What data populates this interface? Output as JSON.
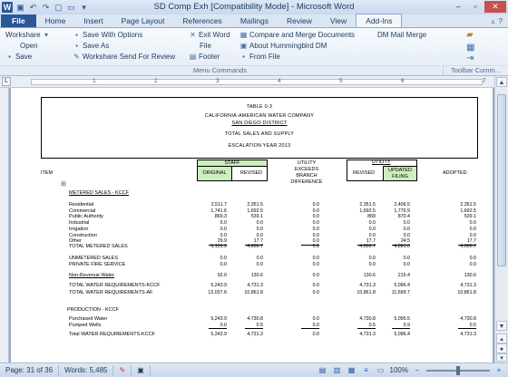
{
  "window": {
    "title": "SD Comp Exh [Compatibility Mode] - Microsoft Word",
    "app_letter": "W"
  },
  "ribbon_tabs": [
    "Home",
    "Insert",
    "Page Layout",
    "References",
    "Mailings",
    "Review",
    "View",
    "Add-Ins"
  ],
  "file_tab": "File",
  "ribbon": {
    "workshare": "Workshare",
    "open": "Open",
    "save": "Save",
    "save_with_options": "Save With Options",
    "save_as": "Save As",
    "workshare_send": "Workshare Send For Review",
    "exit_word": "Exit Word",
    "file": "File",
    "footer": "Footer",
    "compare_merge": "Compare and Merge Documents",
    "about_hummingbird": "About Hummingbird DM",
    "from_file": "From File",
    "dm_mail_merge": "DM Mail Merge",
    "menu_commands": "Menu Commands",
    "toolbar_commands": "Toolbar Comm..."
  },
  "ruler_numbers": [
    "1",
    "2",
    "3",
    "4",
    "5",
    "6",
    "7"
  ],
  "doc": {
    "table_no": "TABLE 0-3",
    "company": "CALIFORNIA-AMERICAN WATER COMPANY",
    "district": "SAN DIEGO DISTRICT",
    "subtitle": "TOTAL SALES AND SUPPLY",
    "year": "ESCALATION  YEAR 2013",
    "col_staff": "STAFF",
    "col_utility": "UTILITY",
    "col_original": "ORIGINAL",
    "col_revised": "REVISED",
    "col_exceeds": "UTILITY EXCEEDS BRANCH DIFFERENCE",
    "col_u_revised": "REVISED",
    "col_updated": "UPDATED FILING",
    "col_adopted": "ADOPTED",
    "item": "ITEM",
    "metered_sales": "METERED SALES - KCCF",
    "rows": [
      {
        "label": "Residential",
        "v": [
          "2,511.7",
          "2,351.5",
          "0.0",
          "2,351.5",
          "2,406.5",
          "2,351.5"
        ]
      },
      {
        "label": "Commercial",
        "v": [
          "1,741.6",
          "1,692.5",
          "0.0",
          "1,692.5",
          "1,776.9",
          "1,692.5"
        ]
      },
      {
        "label": "Public Authority",
        "v": "869.3|539.1|0.0|869|870.4|539.1"
      },
      {
        "label": "Industrial",
        "v": [
          "0.0",
          "0.0",
          "0.0",
          "0.0",
          "0.0",
          "0.0"
        ]
      },
      {
        "label": "Irrigation",
        "v": [
          "0.0",
          "0.0",
          "0.0",
          "0.0",
          "0.0",
          "0.0"
        ]
      },
      {
        "label": "Construction",
        "v": [
          "0.0",
          "0.0",
          "0.0",
          "0.0",
          "0.0",
          "0.0"
        ]
      },
      {
        "label": "Other",
        "v": [
          "29.9",
          "17.7",
          "0.0",
          "17.7",
          "24.5",
          "17.7"
        ]
      }
    ],
    "total_metered": {
      "label": "TOTAL METERED SALES",
      "v": [
        "5,151.9",
        "4,600.7",
        "0.0",
        "4,600.7",
        "4,891.0",
        "4,600.7"
      ]
    },
    "unmetered": {
      "label": "UNMETERED SALES",
      "v": [
        "0.0",
        "0.0",
        "0.0",
        "0.0",
        "0.0",
        "0.0"
      ]
    },
    "private_fire": {
      "label": "PRIVATE FIRE SERVICE",
      "v": [
        "0.0",
        "0.0",
        "0.0",
        "0.0",
        "0.0",
        "0.0"
      ]
    },
    "nonrevenue": {
      "label": "Non-Revenue Water",
      "v": [
        "92.0",
        "130.6",
        "0.0",
        "130.6",
        "215.4",
        "130.6"
      ]
    },
    "total_req_kccf": {
      "label": "TOTAL WATER REQUIREMENTS-KCCF",
      "v": [
        "5,243.9",
        "4,731.3",
        "0.0",
        "4,731.3",
        "5,096.4",
        "4,731.3"
      ]
    },
    "total_req_af": {
      "label": "TOTAL WATER REQUIREMENTS-AF",
      "v": [
        "12,037.6",
        "10,861.8",
        "0.0",
        "10,861.8",
        "11,699.7",
        "10,861.8"
      ]
    },
    "production": "PRODUCTION - KCCF",
    "purchased": {
      "label": "Purchased Water",
      "v": [
        "5,243.9",
        "4,730.8",
        "0.0",
        "4,730.8",
        "5,095.5",
        "4,730.8"
      ]
    },
    "pumped": {
      "label": "Pumped Wells",
      "v": [
        "0.0",
        "0.5",
        "0.0",
        "0.5",
        "0.9",
        "0.5"
      ]
    },
    "total_req_kccf2": {
      "label": "Total WATER REQUIREMENTS-KCCF",
      "v": [
        "5,243.9",
        "4,731.3",
        "0.0",
        "4,731.3",
        "5,096.4",
        "4,731.3"
      ]
    }
  },
  "status": {
    "page": "Page: 31 of 36",
    "words": "Words: 5,485",
    "zoom": "100%"
  }
}
